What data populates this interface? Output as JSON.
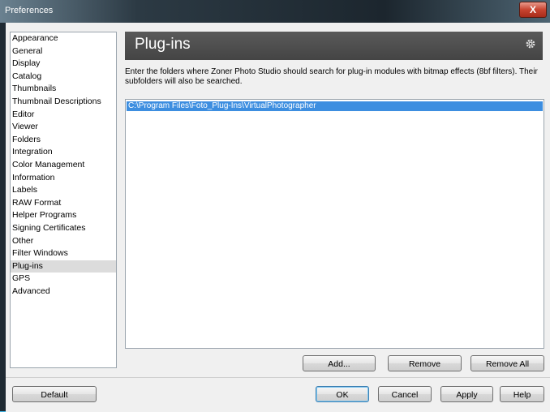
{
  "window": {
    "title": "Preferences",
    "close_label": "X"
  },
  "sidebar": {
    "items": [
      {
        "label": "Appearance",
        "active": false
      },
      {
        "label": "General",
        "active": false
      },
      {
        "label": "Display",
        "active": false
      },
      {
        "label": "Catalog",
        "active": false
      },
      {
        "label": "Thumbnails",
        "active": false
      },
      {
        "label": "Thumbnail Descriptions",
        "active": false
      },
      {
        "label": "Editor",
        "active": false
      },
      {
        "label": "Viewer",
        "active": false
      },
      {
        "label": "Folders",
        "active": false
      },
      {
        "label": "Integration",
        "active": false
      },
      {
        "label": "Color Management",
        "active": false
      },
      {
        "label": "Information",
        "active": false
      },
      {
        "label": "Labels",
        "active": false
      },
      {
        "label": "RAW Format",
        "active": false
      },
      {
        "label": "Helper Programs",
        "active": false
      },
      {
        "label": "Signing Certificates",
        "active": false
      },
      {
        "label": "Other",
        "active": false
      },
      {
        "label": "Filter Windows",
        "active": false
      },
      {
        "label": "Plug-ins",
        "active": true
      },
      {
        "label": "GPS",
        "active": false
      },
      {
        "label": "Advanced",
        "active": false
      }
    ]
  },
  "main": {
    "header_title": "Plug-ins",
    "header_icon": "gear-icon",
    "description": "Enter the folders where Zoner Photo Studio should search for plug-in modules with bitmap effects (8bf filters). Their subfolders will also be searched.",
    "folders": [
      "C:\\Program Files\\Foto_Plug-Ins\\VirtualPhotographer"
    ],
    "buttons": {
      "add": "Add...",
      "remove": "Remove",
      "remove_all": "Remove All"
    }
  },
  "footer": {
    "default": "Default",
    "ok": "OK",
    "cancel": "Cancel",
    "apply": "Apply",
    "help": "Help"
  },
  "colors": {
    "selection": "#3d8ee0",
    "header_bg": "#4a4a4a",
    "close_button": "#c8432f"
  }
}
